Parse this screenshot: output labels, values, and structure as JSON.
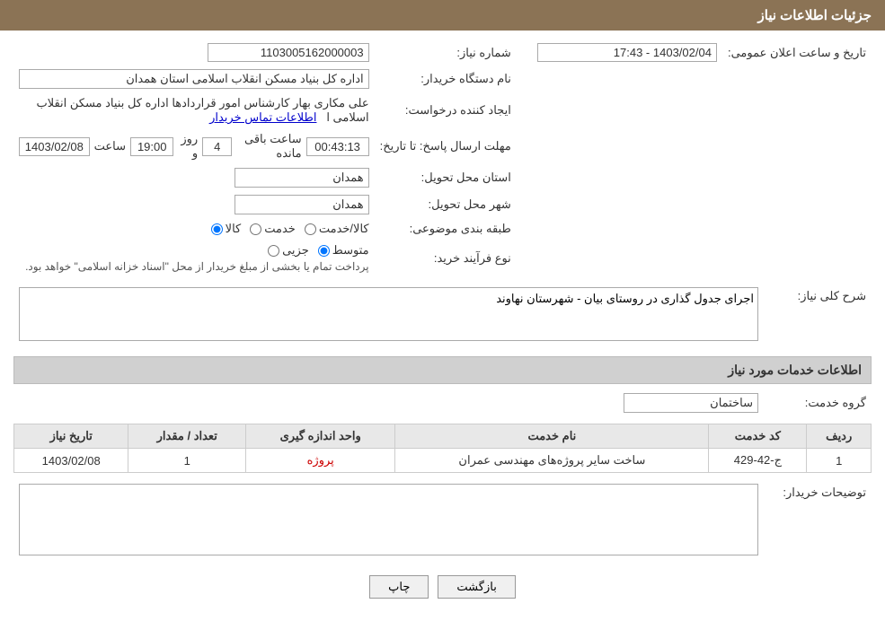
{
  "page": {
    "title": "جزئیات اطلاعات نیاز",
    "sections": {
      "need_info": "جزئیات اطلاعات نیاز",
      "service_info": "اطلاعات خدمات مورد نیاز"
    }
  },
  "fields": {
    "need_number_label": "شماره نیاز:",
    "need_number_value": "1103005162000003",
    "buyer_org_label": "نام دستگاه خریدار:",
    "buyer_org_value": "اداره کل بنیاد مسکن انقلاب اسلامی استان همدان",
    "creator_label": "ایجاد کننده درخواست:",
    "creator_value": "علی مکاری بهار کارشناس امور قراردادها اداره کل بنیاد مسکن انقلاب اسلامی ا",
    "creator_link": "اطلاعات تماس خریدار",
    "deadline_label": "مهلت ارسال پاسخ: تا تاریخ:",
    "deadline_date": "1403/02/08",
    "deadline_time_label": "ساعت",
    "deadline_time": "19:00",
    "deadline_days_label": "روز و",
    "deadline_days": "4",
    "deadline_remaining_label": "ساعت باقی مانده",
    "deadline_remaining": "00:43:13",
    "announce_label": "تاریخ و ساعت اعلان عمومی:",
    "announce_value": "1403/02/04 - 17:43",
    "province_label": "استان محل تحویل:",
    "province_value": "همدان",
    "city_label": "شهر محل تحویل:",
    "city_value": "همدان",
    "category_label": "طبقه بندی موضوعی:",
    "category_goods": "کالا",
    "category_service": "خدمت",
    "category_goods_service": "کالا/خدمت",
    "purchase_type_label": "نوع فرآیند خرید:",
    "purchase_partial": "جزیی",
    "purchase_medium": "متوسط",
    "purchase_note": "پرداخت تمام یا بخشی از مبلغ خریدار از محل \"اسناد خزانه اسلامی\" خواهد بود.",
    "need_desc_label": "شرح کلی نیاز:",
    "need_desc_value": "اجرای جدول گذاری در روستای بیان - شهرستان نهاوند",
    "service_group_label": "گروه خدمت:",
    "service_group_value": "ساختمان",
    "table": {
      "col_row": "ردیف",
      "col_code": "کد خدمت",
      "col_name": "نام خدمت",
      "col_unit": "واحد اندازه گیری",
      "col_count": "تعداد / مقدار",
      "col_date": "تاریخ نیاز",
      "rows": [
        {
          "row": "1",
          "code": "ج-42-429",
          "name": "ساخت سایر پروژه‌های مهندسی عمران",
          "unit": "پروژه",
          "count": "1",
          "date": "1403/02/08"
        }
      ]
    },
    "buyer_desc_label": "توضیحات خریدار:",
    "buyer_desc_value": "",
    "btn_print": "چاپ",
    "btn_back": "بازگشت"
  }
}
